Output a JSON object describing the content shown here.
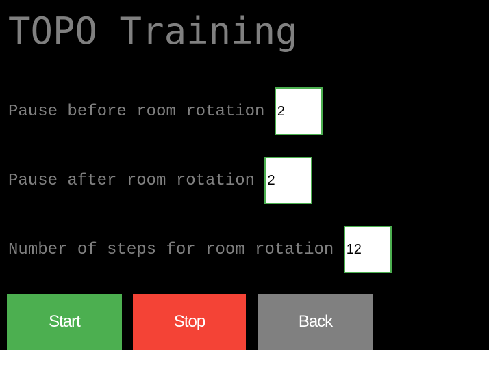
{
  "title": "TOPO Training",
  "form": {
    "pause_before": {
      "label": "Pause before room rotation ",
      "value": "2"
    },
    "pause_after": {
      "label": "Pause after room rotation ",
      "value": "2"
    },
    "steps": {
      "label": "Number of steps for room rotation ",
      "value": "12"
    }
  },
  "buttons": {
    "start_label": "Start",
    "stop_label": "Stop",
    "back_label": "Back"
  },
  "colors": {
    "background": "#000000",
    "text": "#808080",
    "field_border": "#4caf50",
    "start": "#4caf50",
    "stop": "#f44336",
    "back": "#808080"
  }
}
